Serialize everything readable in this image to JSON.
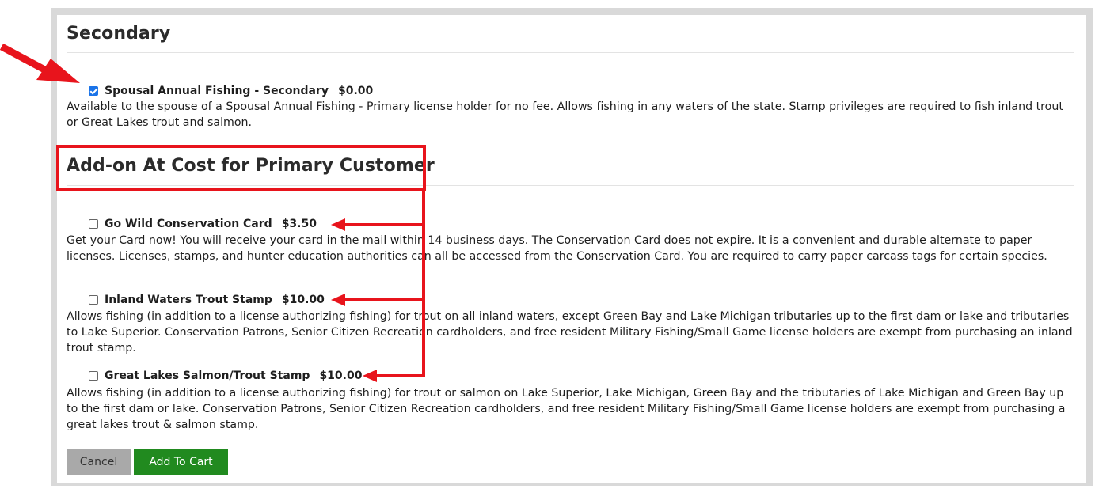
{
  "secondary": {
    "heading": "Secondary",
    "item": {
      "name": "Spousal Annual Fishing - Secondary",
      "price": "$0.00",
      "checked": true,
      "description": "Available to the spouse of a Spousal Annual Fishing - Primary license holder for no fee. Allows fishing in any waters of the state. Stamp privileges are required to fish inland trout or Great Lakes trout and salmon."
    }
  },
  "addons": {
    "heading": "Add-on At Cost for Primary Customer",
    "items": [
      {
        "name": "Go Wild Conservation Card",
        "price": "$3.50",
        "checked": false,
        "description": "Get your Card now! You will receive your card in the mail within 14 business days. The Conservation Card does not expire. It is a convenient and durable alternate to paper licenses. Licenses, stamps, and hunter education authorities can all be accessed from the Conservation Card. You are required to carry paper carcass tags for certain species."
      },
      {
        "name": "Inland Waters Trout Stamp",
        "price": "$10.00",
        "checked": false,
        "description": "Allows fishing (in addition to a license authorizing fishing) for trout on all inland waters, except Green Bay and Lake Michigan tributaries up to the first dam or lake and tributaries to Lake Superior. Conservation Patrons, Senior Citizen Recreation cardholders, and free resident Military Fishing/Small Game license holders are exempt from purchasing an inland trout stamp."
      },
      {
        "name": "Great Lakes Salmon/Trout Stamp",
        "price": "$10.00",
        "checked": false,
        "description": "Allows fishing (in addition to a license authorizing fishing) for trout or salmon on Lake Superior, Lake Michigan, Green Bay and the tributaries of Lake Michigan and Green Bay up to the first dam or lake. Conservation Patrons, Senior Citizen Recreation cardholders, and free resident Military Fishing/Small Game license holders are exempt from purchasing a great lakes trout & salmon stamp."
      }
    ]
  },
  "buttons": {
    "cancel": "Cancel",
    "add_to_cart": "Add To Cart"
  },
  "colors": {
    "annotation_red": "#e8141c",
    "checkbox_blue": "#1a73e8",
    "add_button_green": "#218a1f",
    "cancel_button_gray": "#a9a9a9"
  }
}
